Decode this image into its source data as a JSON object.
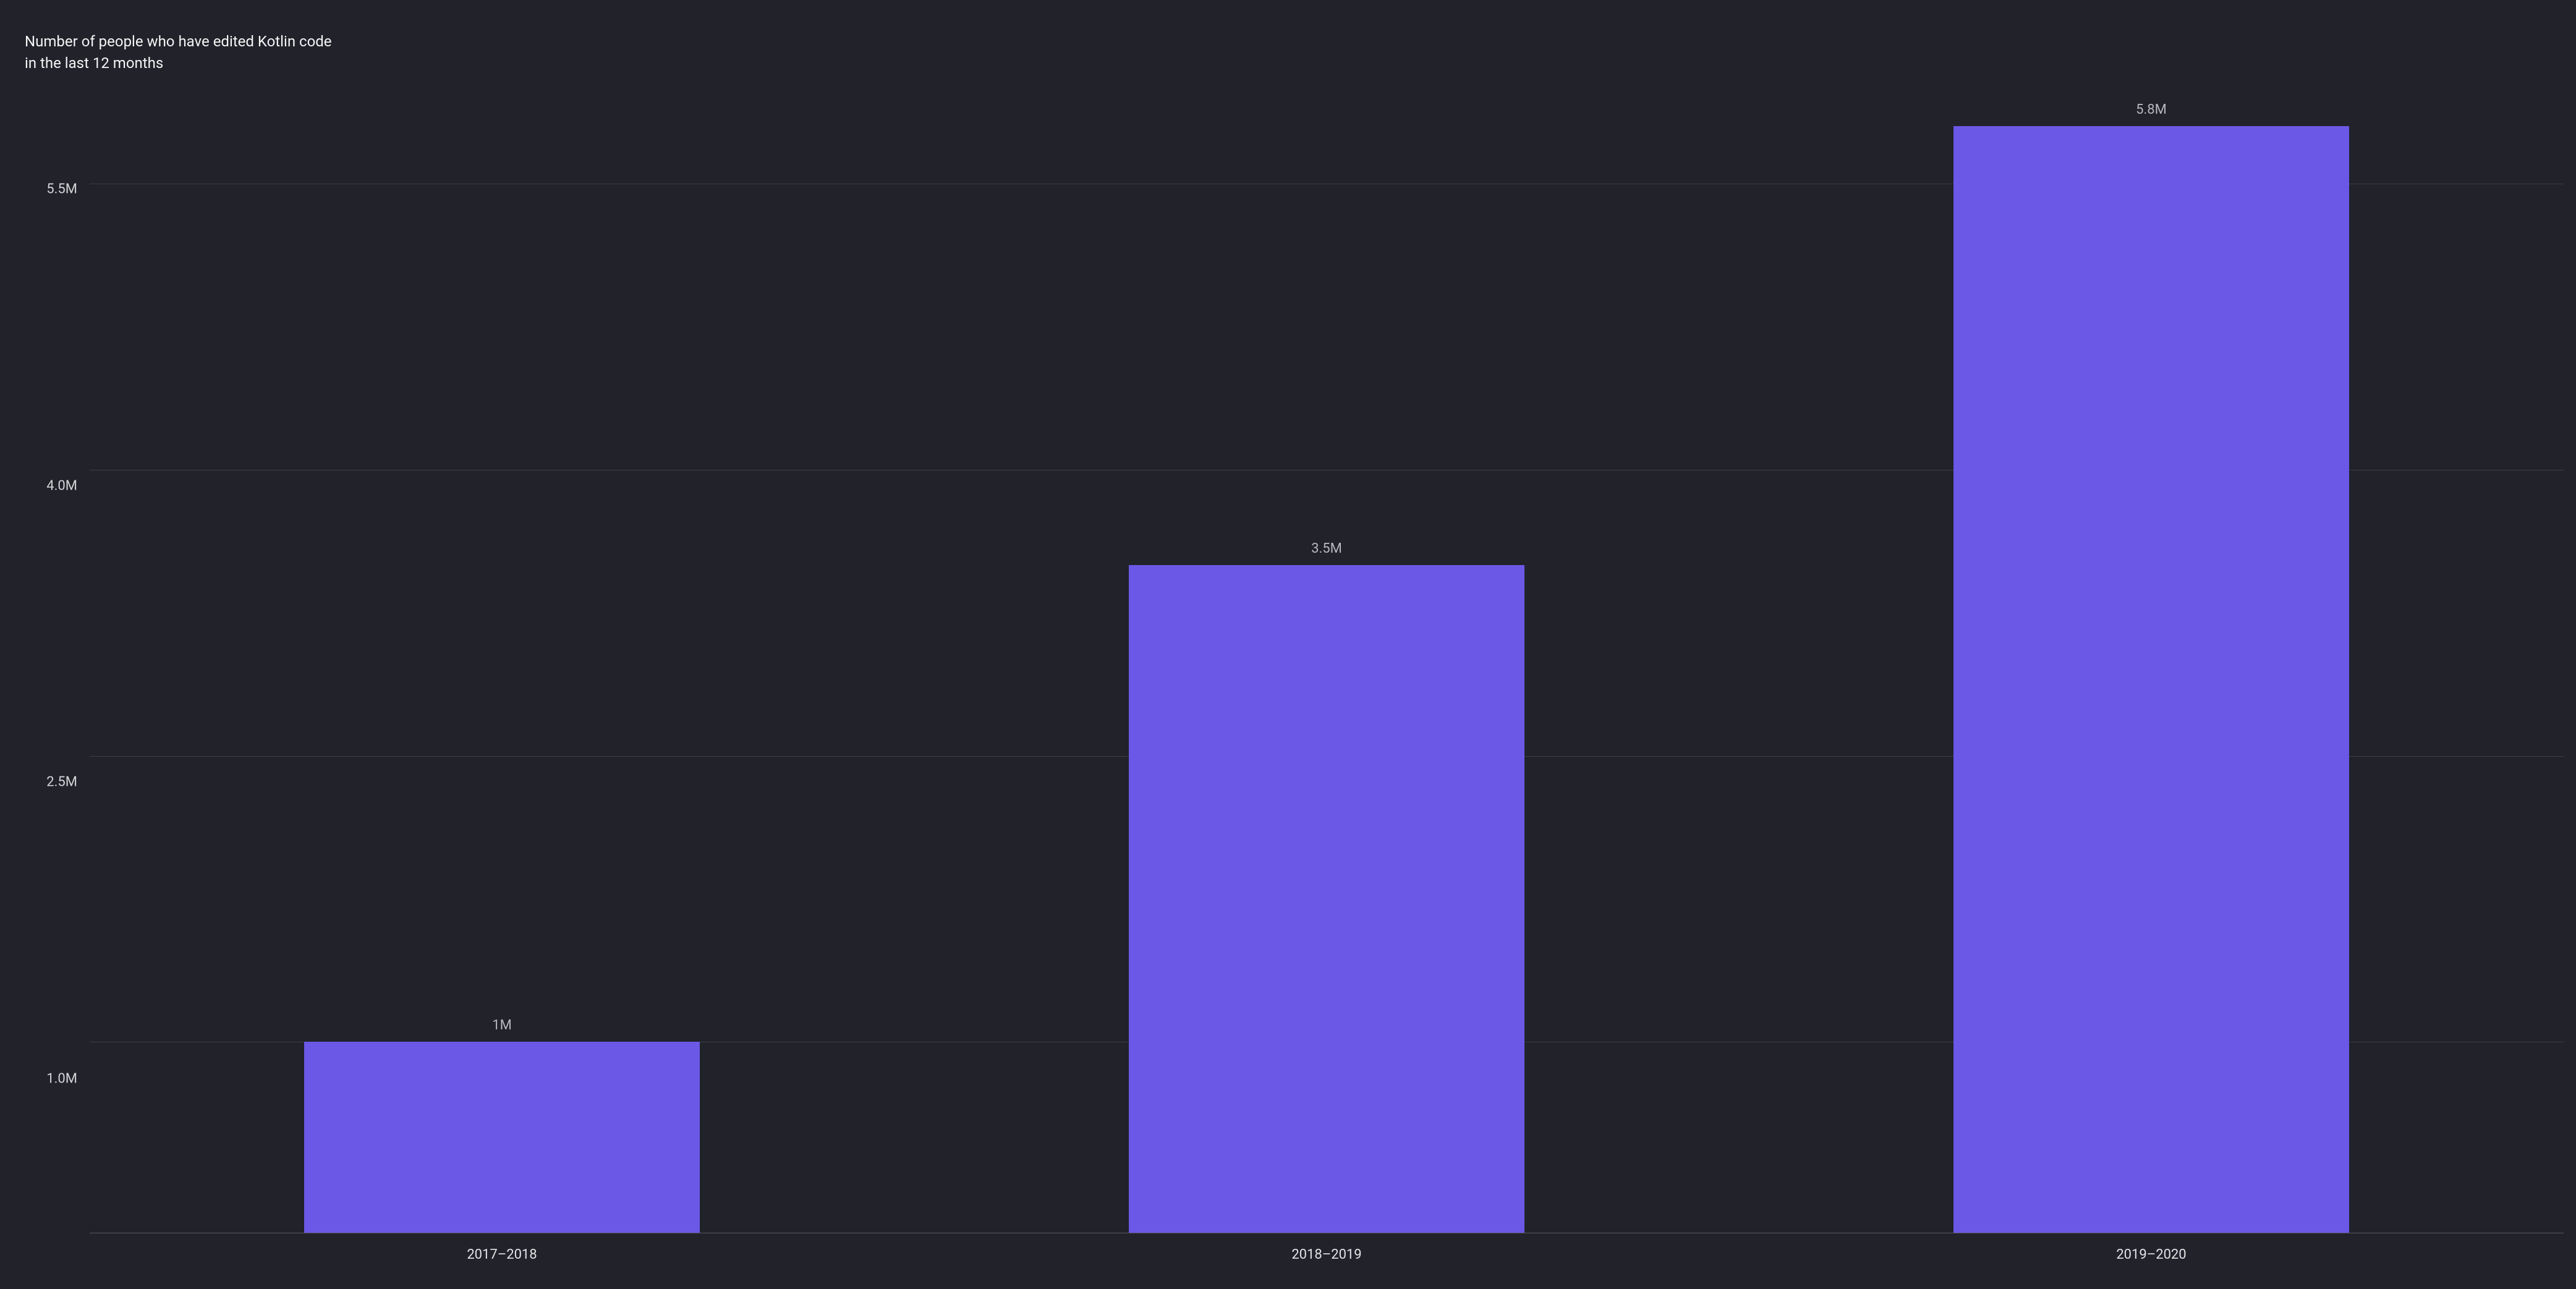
{
  "chart_data": {
    "type": "bar",
    "title": "Number of people who have edited Kotlin code in the last 12 months",
    "categories": [
      "2017–2018",
      "2018–2019",
      "2019–2020"
    ],
    "values": [
      1.0,
      3.5,
      5.8
    ],
    "value_labels": [
      "1M",
      "3.5M",
      "5.8M"
    ],
    "y_ticks": [
      1.0,
      2.5,
      4.0,
      5.5
    ],
    "y_tick_labels": [
      "1.0M",
      "2.5M",
      "4.0M",
      "5.5M"
    ],
    "ylim": [
      0,
      6.3
    ],
    "bar_color": "#6b58e6",
    "background_color": "#21222a",
    "grid_color": "#3c3d45"
  }
}
